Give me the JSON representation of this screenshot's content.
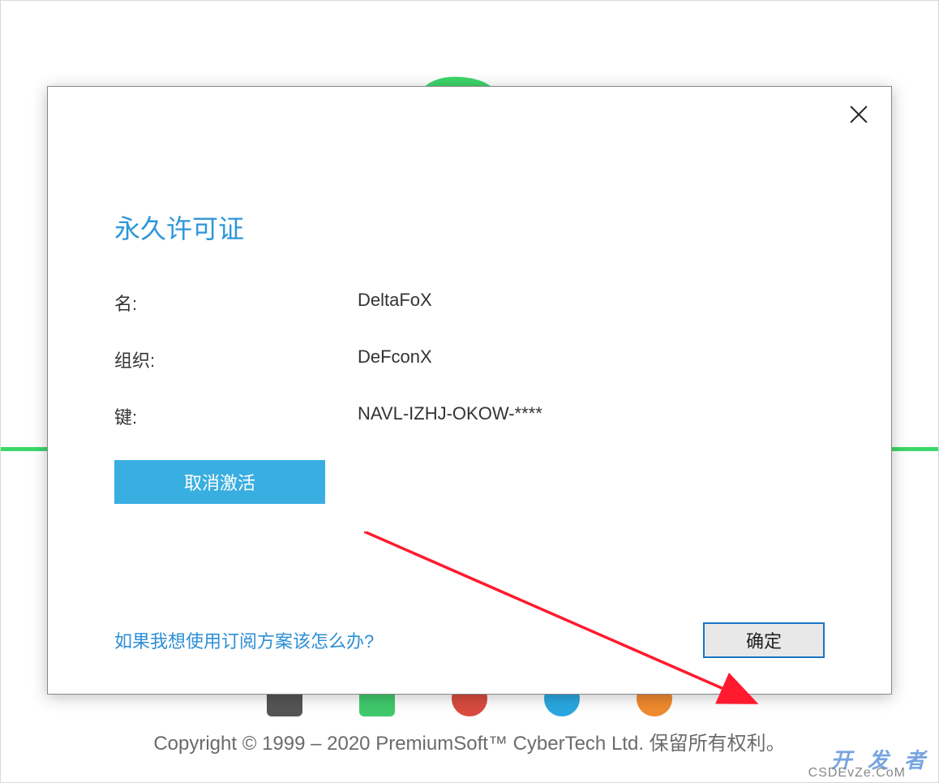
{
  "dialog": {
    "title": "永久许可证",
    "fields": {
      "name_label": "名:",
      "name_value": "DeltaFoX",
      "org_label": "组织:",
      "org_value": "DeFconX",
      "key_label": "键:",
      "key_value": "NAVL-IZHJ-OKOW-****"
    },
    "deactivate_button": "取消激活",
    "subscription_link": "如果我想使用订阅方案该怎么办?",
    "ok_button": "确定"
  },
  "copyright": "Copyright © 1999 – 2020 PremiumSoft™ CyberTech Ltd. 保留所有权利。",
  "watermark_main": "开 发 者",
  "watermark_sub": "CSDEvZe.CoM",
  "bg_icon_colors": [
    "#555555",
    "#3fc96b",
    "#d94b3f",
    "#2aa7e0",
    "#f08a2e"
  ],
  "colors": {
    "accent_green": "#3dd66a",
    "link_blue": "#2d8fd6",
    "title_blue": "#2d96d8",
    "button_blue": "#39aee0",
    "ok_border": "#1b74c4",
    "arrow_red": "#ff1a2e"
  }
}
